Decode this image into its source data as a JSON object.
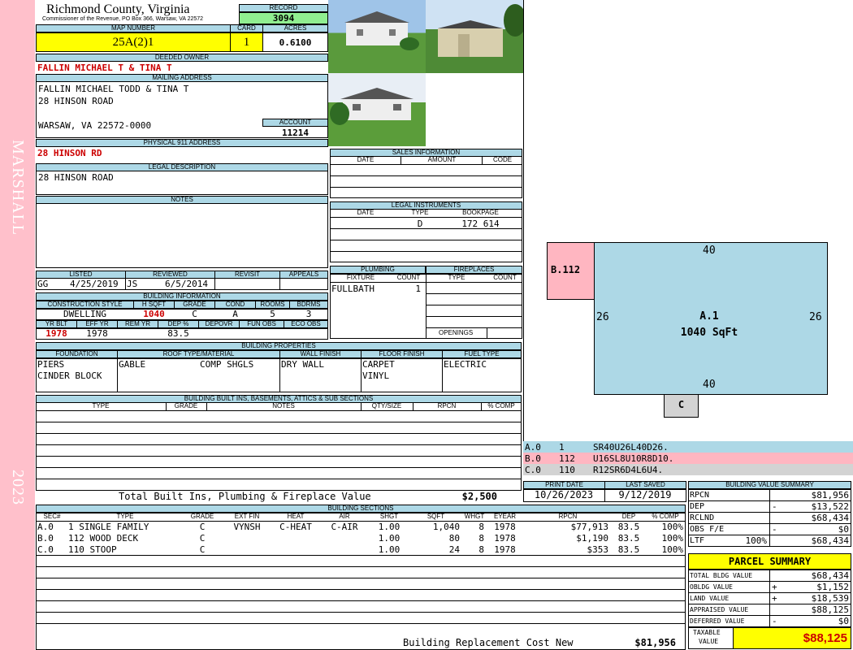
{
  "sidebar": {
    "district": "MARSHALL",
    "year": "2023"
  },
  "header": {
    "county": "Richmond County, Virginia",
    "commissioner": "Commissioner of the Revenue, PO Box 366, Warsaw, VA 22572",
    "record_label": "RECORD",
    "record": "3094",
    "map_label": "MAP NUMBER",
    "map_number": "25A(2)1",
    "card_label": "CARD",
    "card": "1",
    "acres_label": "ACRES",
    "acres": "0.6100"
  },
  "owner": {
    "label": "DEEDED OWNER",
    "name": "FALLIN MICHAEL T & TINA T"
  },
  "mailing": {
    "label": "MAILING ADDRESS",
    "line1": "FALLIN MICHAEL TODD & TINA T",
    "line2": "28 HINSON ROAD",
    "line3": "WARSAW, VA 22572-0000",
    "account_label": "ACCOUNT",
    "account": "11214"
  },
  "physical": {
    "label": "PHYSICAL 911 ADDRESS",
    "address": "28 HINSON RD"
  },
  "legal": {
    "label": "LEGAL DESCRIPTION",
    "text": "28 HINSON ROAD"
  },
  "notes": {
    "label": "NOTES"
  },
  "sales": {
    "label": "SALES INFORMATION",
    "col_date": "DATE",
    "col_amount": "AMOUNT",
    "col_code": "CODE"
  },
  "instruments": {
    "label": "LEGAL INSTRUMENTS",
    "col_date": "DATE",
    "col_type": "TYPE",
    "col_bookpage": "BOOKPAGE",
    "type": "D",
    "bookpage": "172 614"
  },
  "review": {
    "listed_label": "LISTED",
    "reviewed_label": "REVIEWED",
    "revisit_label": "REVISIT",
    "appeals_label": "APPEALS",
    "listed_by": "GG",
    "listed_date": "4/25/2019",
    "reviewed_by": "JS",
    "reviewed_date": "6/5/2014"
  },
  "building": {
    "label": "BUILDING INFORMATION",
    "cs_label": "CONSTRUCTION STYLE",
    "hsqft_label": "H SQFT",
    "grade_label": "GRADE",
    "cond_label": "COND",
    "rooms_label": "ROOMS",
    "bdrms_label": "BDRMS",
    "style": "DWELLING",
    "hsqft": "1040",
    "grade": "C",
    "cond": "A",
    "rooms": "5",
    "bdrms": "3",
    "yrblt_label": "YR BLT",
    "effyr_label": "EFF YR",
    "remyr_label": "REM YR",
    "dep_label": "DEP %",
    "depovr_label": "DEPOVR",
    "funobs_label": "FUN OBS",
    "ecoobs_label": "ECO OBS",
    "yrblt": "1978",
    "effyr": "1978",
    "dep": "83.5"
  },
  "plumbing": {
    "label": "PLUMBING",
    "fixture_label": "FIXTURE",
    "count_label": "COUNT",
    "fixture": "FULLBATH",
    "count": "1"
  },
  "fireplaces": {
    "label": "FIREPLACES",
    "type_label": "TYPE",
    "count_label": "COUNT",
    "openings_label": "OPENINGS"
  },
  "properties": {
    "label": "BUILDING PROPERTIES",
    "foundation_label": "FOUNDATION",
    "roof_label": "ROOF TYPE/MATERIAL",
    "wall_label": "WALL FINISH",
    "floor_label": "FLOOR FINISH",
    "fuel_label": "FUEL TYPE",
    "foundation1": "PIERS",
    "foundation2": "CINDER BLOCK",
    "roof_type": "GABLE",
    "roof_material": "COMP SHGLS",
    "wall": "DRY WALL",
    "floor1": "CARPET",
    "floor2": "VINYL",
    "fuel": "ELECTRIC"
  },
  "builtins": {
    "label": "BUILDING BUILT INS, BASEMENTS, ATTICS & SUB SECTIONS",
    "col_type": "TYPE",
    "col_grade": "GRADE",
    "col_notes": "NOTES",
    "col_qty": "QTY/SIZE",
    "col_rpcn": "RPCN",
    "col_comp": "% COMP",
    "total_label": "Total Built Ins, Plumbing & Fireplace Value",
    "total": "$2,500"
  },
  "sections": {
    "label": "BUILDING SECTIONS",
    "headers": [
      "SEC#",
      "TYPE",
      "GRADE",
      "EXT FIN",
      "HEAT",
      "AIR",
      "SHGT",
      "SQFT",
      "WHGT",
      "EYEAR",
      "RPCN",
      "DEP",
      "% COMP"
    ],
    "rows": [
      {
        "sec": "A.0",
        "type": "1 SINGLE FAMILY",
        "grade": "C",
        "extfin": "VYNSH",
        "heat": "C-HEAT",
        "air": "C-AIR",
        "shgt": "1.00",
        "sqft": "1,040",
        "whgt": "8",
        "eyear": "1978",
        "rpcn": "$77,913",
        "dep": "83.5",
        "comp": "100%"
      },
      {
        "sec": "B.0",
        "type": "112 WOOD DECK",
        "grade": "C",
        "extfin": "",
        "heat": "",
        "air": "",
        "shgt": "1.00",
        "sqft": "80",
        "whgt": "8",
        "eyear": "1978",
        "rpcn": "$1,190",
        "dep": "83.5",
        "comp": "100%"
      },
      {
        "sec": "C.0",
        "type": "110 STOOP",
        "grade": "C",
        "extfin": "",
        "heat": "",
        "air": "",
        "shgt": "1.00",
        "sqft": "24",
        "whgt": "8",
        "eyear": "1978",
        "rpcn": "$353",
        "dep": "83.5",
        "comp": "100%"
      }
    ],
    "brcn_label": "Building Replacement Cost New",
    "brcn": "$81,956"
  },
  "sketch": {
    "top": "40",
    "bottom": "40",
    "left": "26",
    "right": "26",
    "main": "A.1",
    "area": "1040 SqFt",
    "deck": "B.112",
    "stoop": "C",
    "colors": {
      "main": "#add8e6",
      "deck": "#ffb6c1",
      "stoop": "#d3d3d3"
    }
  },
  "legend": [
    {
      "sec": "A.0",
      "code": "1",
      "path": "SR40U26L40D26."
    },
    {
      "sec": "B.0",
      "code": "112",
      "path": "U16SL8U10R8D10."
    },
    {
      "sec": "C.0",
      "code": "110",
      "path": "R12SR6D4L6U4."
    }
  ],
  "dates": {
    "print_label": "PRINT DATE",
    "saved_label": "LAST SAVED",
    "print": "10/26/2023",
    "saved": "9/12/2019"
  },
  "bvs": {
    "label": "BUILDING VALUE SUMMARY",
    "rpcn_label": "RPCN",
    "rpcn": "$81,956",
    "dep_label": "DEP",
    "dep_sign": "-",
    "dep": "$13,522",
    "rclnd_label": "RCLND",
    "rclnd": "$68,434",
    "obs_label": "OBS F/E",
    "obs_sign": "-",
    "obs": "$0",
    "ltf_label": "LTF",
    "ltf_pct": "100%",
    "ltf": "$68,434"
  },
  "parcel": {
    "label": "PARCEL SUMMARY",
    "tbv_label": "TOTAL BLDG VALUE",
    "tbv": "$68,434",
    "obldg_label": "OBLDG VALUE",
    "obldg_sign": "+",
    "obldg": "$1,152",
    "land_label": "LAND VALUE",
    "land_sign": "+",
    "land": "$18,539",
    "appr_label": "APPRAISED VALUE",
    "appr": "$88,125",
    "def_label": "DEFERRED VALUE",
    "def_sign": "-",
    "def": "$0",
    "tax_label1": "TAXABLE",
    "tax_label2": "VALUE",
    "tax": "$88,125"
  }
}
